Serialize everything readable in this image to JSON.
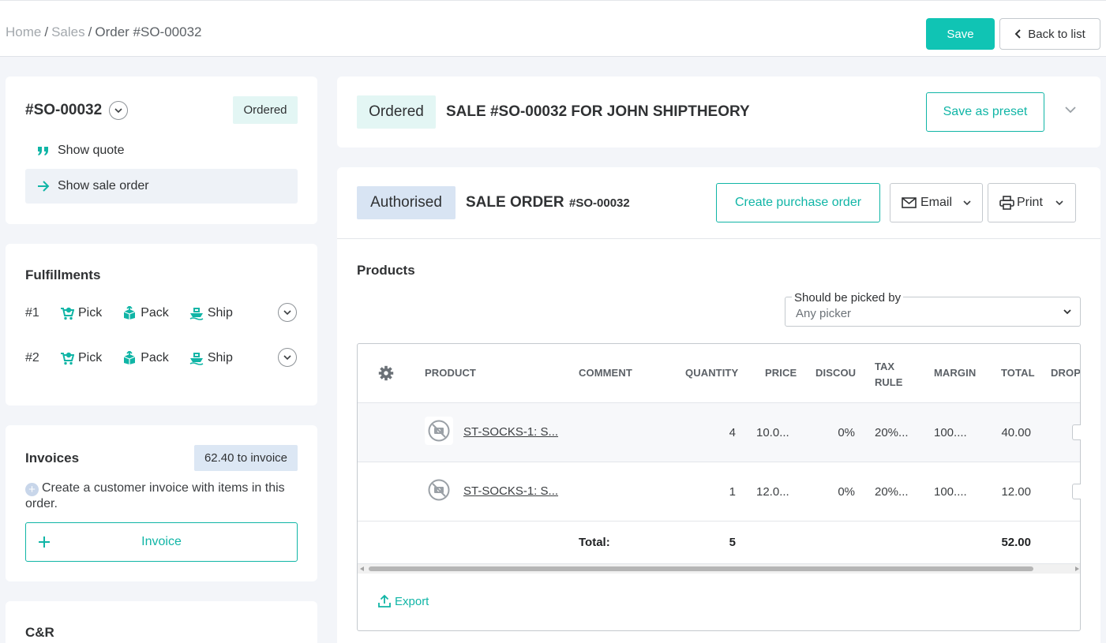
{
  "breadcrumb": {
    "home": "Home",
    "sales": "Sales",
    "current": "Order #SO-00032",
    "sep": "/"
  },
  "header": {
    "save_label": "Save",
    "back_label": "Back to list"
  },
  "order_card": {
    "number": "#SO-00032",
    "status": "Ordered",
    "menu": [
      {
        "label": "Show quote",
        "icon": "quote-icon"
      },
      {
        "label": "Show sale order",
        "icon": "arrow-right-icon"
      }
    ]
  },
  "fulfillments": {
    "title": "Fulfillments",
    "rows": [
      {
        "num": "#1",
        "pick": "Pick",
        "pack": "Pack",
        "ship": "Ship"
      },
      {
        "num": "#2",
        "pick": "Pick",
        "pack": "Pack",
        "ship": "Ship"
      }
    ]
  },
  "invoices": {
    "title": "Invoices",
    "badge": "62.40 to invoice",
    "hint": "Create a customer invoice with items in this order.",
    "button": "Invoice"
  },
  "cr": {
    "title": "C&R"
  },
  "sale_header": {
    "status": "Ordered",
    "title": "SALE #SO-00032 FOR JOHN SHIPTHEORY",
    "preset_button": "Save as preset"
  },
  "sale_order": {
    "status": "Authorised",
    "title": "SALE ORDER",
    "number": "#SO-00032",
    "create_po": "Create purchase order",
    "email": "Email",
    "print": "Print"
  },
  "products": {
    "title": "Products",
    "picker_label": "Should be picked by",
    "picker_value": "Any picker",
    "columns": {
      "product": "PRODUCT",
      "comment": "COMMENT",
      "quantity": "QUANTITY",
      "price": "PRICE",
      "discount": "DISCOU",
      "tax_rule_1": "TAX",
      "tax_rule_2": "RULE",
      "margin": "MARGIN",
      "total": "TOTAL",
      "drop": "DROP"
    },
    "rows": [
      {
        "product": "ST-SOCKS-1: S...",
        "comment": "",
        "quantity": "4",
        "price": "10.0...",
        "discount": "0%",
        "tax": "20%...",
        "margin": "100....",
        "total": "40.00"
      },
      {
        "product": "ST-SOCKS-1: S...",
        "comment": "",
        "quantity": "1",
        "price": "12.0...",
        "discount": "0%",
        "tax": "20%...",
        "margin": "100....",
        "total": "12.00"
      }
    ],
    "totals": {
      "label": "Total:",
      "quantity": "5",
      "total": "52.00"
    },
    "export": "Export"
  },
  "colors": {
    "accent": "#10c4b4",
    "badge_ordered_bg": "#e3f6f4",
    "badge_authorised_bg": "#d8e4f3",
    "invoice_badge_bg": "#dce7f4"
  }
}
